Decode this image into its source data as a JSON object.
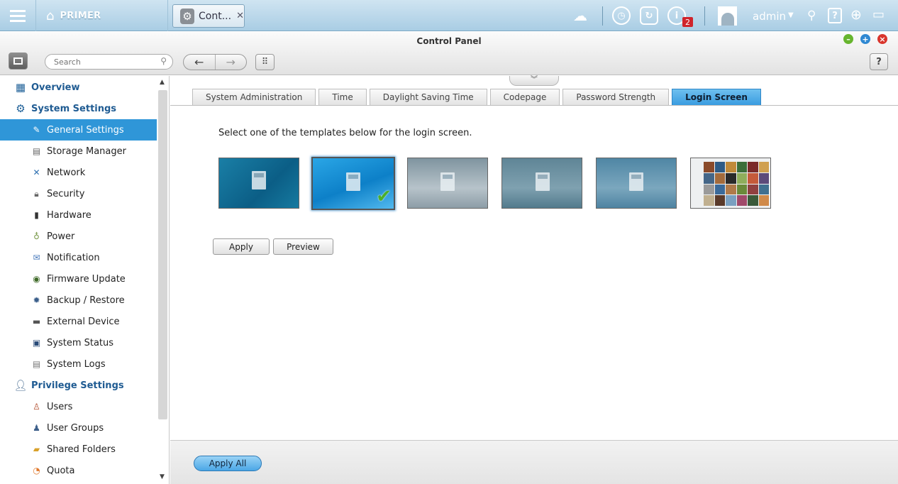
{
  "topbar": {
    "home_label": "PRIMER",
    "app_tab_label": "Cont...",
    "notification_count": "2",
    "username": "admin"
  },
  "window": {
    "title": "Control Panel",
    "search_placeholder": "Search"
  },
  "sidebar": {
    "items": [
      {
        "label": "Overview",
        "type": "group",
        "icon": "overview-icon"
      },
      {
        "label": "System Settings",
        "type": "group",
        "icon": "gear-icon"
      },
      {
        "label": "General Settings",
        "type": "child",
        "icon": "general-settings-icon",
        "active": true
      },
      {
        "label": "Storage Manager",
        "type": "child",
        "icon": "storage-icon"
      },
      {
        "label": "Network",
        "type": "child",
        "icon": "network-icon"
      },
      {
        "label": "Security",
        "type": "child",
        "icon": "lock-icon"
      },
      {
        "label": "Hardware",
        "type": "child",
        "icon": "hardware-icon"
      },
      {
        "label": "Power",
        "type": "child",
        "icon": "bulb-icon"
      },
      {
        "label": "Notification",
        "type": "child",
        "icon": "notification-icon"
      },
      {
        "label": "Firmware Update",
        "type": "child",
        "icon": "firmware-icon"
      },
      {
        "label": "Backup / Restore",
        "type": "child",
        "icon": "backup-icon"
      },
      {
        "label": "External Device",
        "type": "child",
        "icon": "external-device-icon"
      },
      {
        "label": "System Status",
        "type": "child",
        "icon": "monitor-icon"
      },
      {
        "label": "System Logs",
        "type": "child",
        "icon": "logs-icon"
      },
      {
        "label": "Privilege Settings",
        "type": "group",
        "icon": "person-icon"
      },
      {
        "label": "Users",
        "type": "child",
        "icon": "user-icon"
      },
      {
        "label": "User Groups",
        "type": "child",
        "icon": "user-groups-icon"
      },
      {
        "label": "Shared Folders",
        "type": "child",
        "icon": "folder-icon"
      },
      {
        "label": "Quota",
        "type": "child",
        "icon": "quota-icon"
      }
    ]
  },
  "tabs": [
    {
      "label": "System Administration",
      "active": false
    },
    {
      "label": "Time",
      "active": false
    },
    {
      "label": "Daylight Saving Time",
      "active": false
    },
    {
      "label": "Codepage",
      "active": false
    },
    {
      "label": "Password Strength",
      "active": false
    },
    {
      "label": "Login Screen",
      "active": true
    }
  ],
  "login_screen": {
    "instruction": "Select one of the templates below for the login screen.",
    "templates": [
      {
        "name": "template-1",
        "style": "teal",
        "selected": false
      },
      {
        "name": "template-2",
        "style": "bright-blue",
        "selected": true
      },
      {
        "name": "template-3",
        "style": "grey-sky",
        "selected": false
      },
      {
        "name": "template-4",
        "style": "blue-grey",
        "selected": false
      },
      {
        "name": "template-5",
        "style": "blue-grey-light",
        "selected": false
      },
      {
        "name": "template-6",
        "style": "photo-wall",
        "selected": false
      }
    ],
    "apply_label": "Apply",
    "preview_label": "Preview"
  },
  "footer": {
    "apply_all_label": "Apply All"
  },
  "colors": {
    "accent": "#2f96d8",
    "group_text": "#1f5b92",
    "badge": "#d0242b"
  }
}
